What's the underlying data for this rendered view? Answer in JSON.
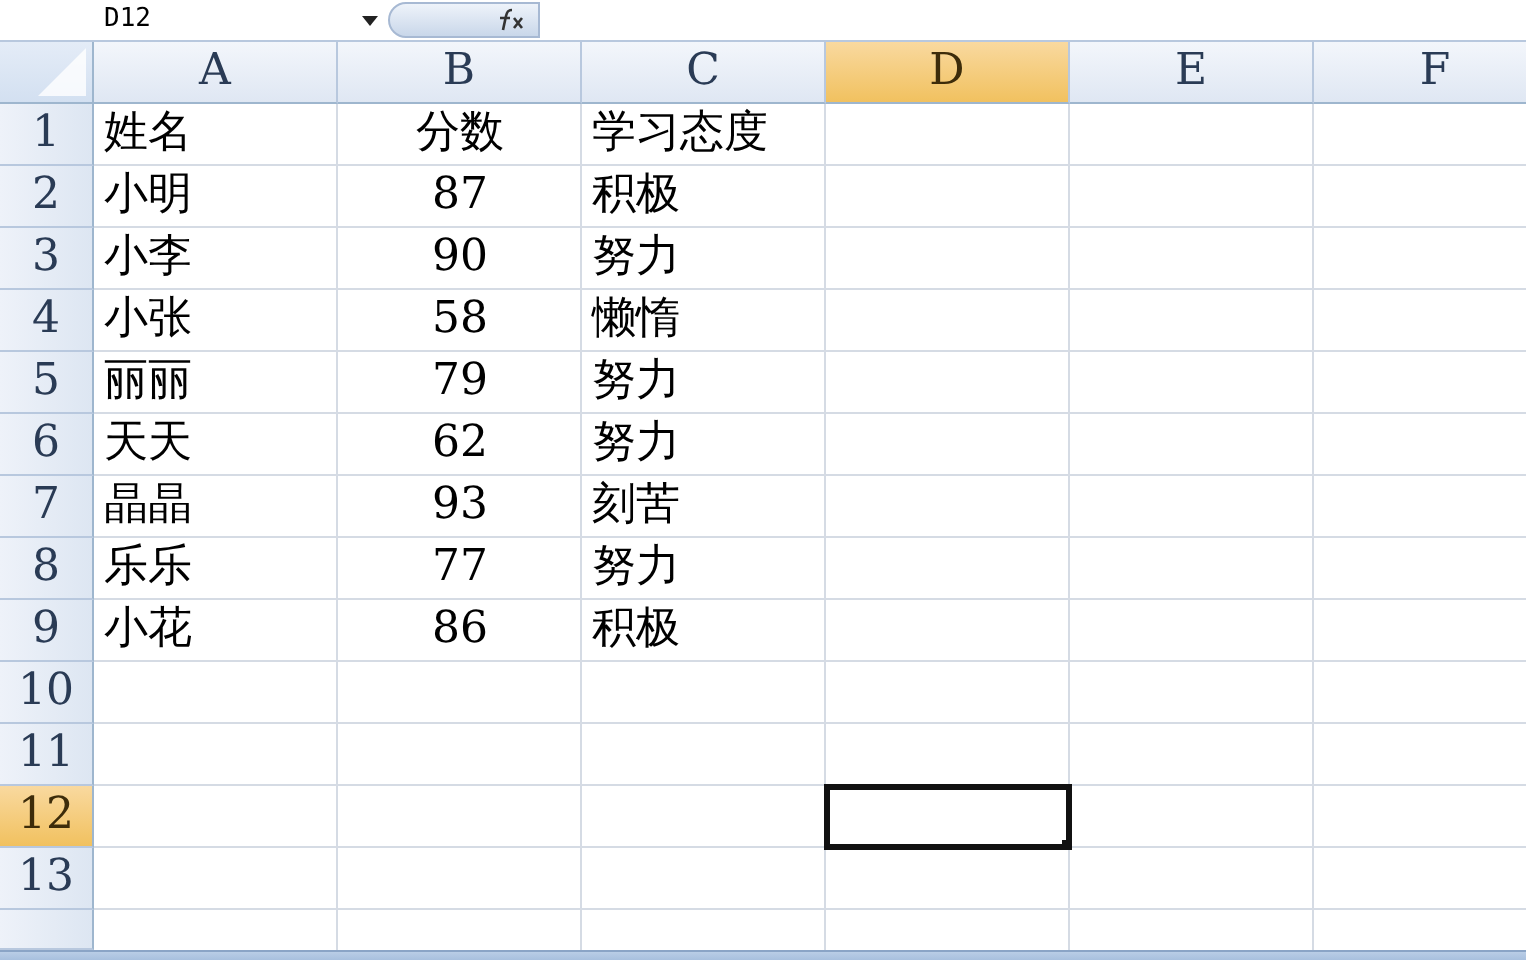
{
  "name_box": "D12",
  "columns": [
    {
      "label": "A",
      "selected": false
    },
    {
      "label": "B",
      "selected": false
    },
    {
      "label": "C",
      "selected": false
    },
    {
      "label": "D",
      "selected": true
    },
    {
      "label": "E",
      "selected": false
    },
    {
      "label": "F",
      "selected": false
    }
  ],
  "rows": [
    {
      "label": "1",
      "selected": false,
      "cells": [
        "姓名",
        "分数",
        "学习态度"
      ]
    },
    {
      "label": "2",
      "selected": false,
      "cells": [
        "小明",
        "87",
        "积极"
      ]
    },
    {
      "label": "3",
      "selected": false,
      "cells": [
        "小李",
        "90",
        "努力"
      ]
    },
    {
      "label": "4",
      "selected": false,
      "cells": [
        "小张",
        "58",
        "懒惰"
      ]
    },
    {
      "label": "5",
      "selected": false,
      "cells": [
        "丽丽",
        "79",
        "努力"
      ]
    },
    {
      "label": "6",
      "selected": false,
      "cells": [
        "天天",
        "62",
        "努力"
      ]
    },
    {
      "label": "7",
      "selected": false,
      "cells": [
        "晶晶",
        "93",
        "刻苦"
      ]
    },
    {
      "label": "8",
      "selected": false,
      "cells": [
        "乐乐",
        "77",
        "努力"
      ]
    },
    {
      "label": "9",
      "selected": false,
      "cells": [
        "小花",
        "86",
        "积极"
      ]
    },
    {
      "label": "10",
      "selected": false,
      "cells": []
    },
    {
      "label": "11",
      "selected": false,
      "cells": []
    },
    {
      "label": "12",
      "selected": true,
      "cells": []
    },
    {
      "label": "13",
      "selected": false,
      "cells": []
    }
  ]
}
